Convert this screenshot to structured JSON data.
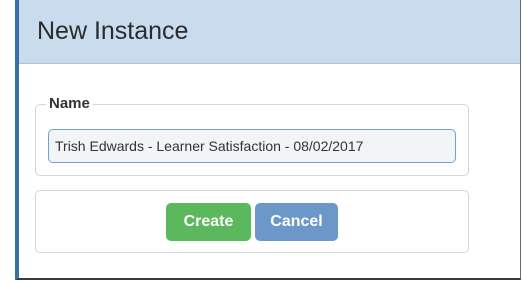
{
  "dialog": {
    "title": "New Instance"
  },
  "name_field": {
    "legend": "Name",
    "value": "Trish Edwards - Learner Satisfaction - 08/02/2017"
  },
  "actions": {
    "create_label": "Create",
    "cancel_label": "Cancel"
  },
  "colors": {
    "header_bg": "#c9dced",
    "accent": "#3a6ea5",
    "create_button": "#5cb85c",
    "cancel_button": "#6b97c9"
  }
}
